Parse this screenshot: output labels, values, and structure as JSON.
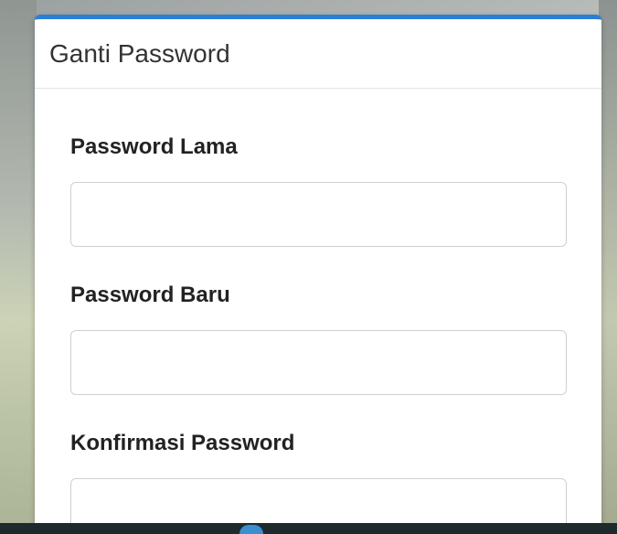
{
  "dialog": {
    "title": "Ganti Password",
    "accent_color": "#2a7fd4"
  },
  "fields": [
    {
      "label": "Password Lama",
      "value": "",
      "placeholder": ""
    },
    {
      "label": "Password Baru",
      "value": "",
      "placeholder": ""
    },
    {
      "label": "Konfirmasi Password",
      "value": "",
      "placeholder": ""
    }
  ]
}
